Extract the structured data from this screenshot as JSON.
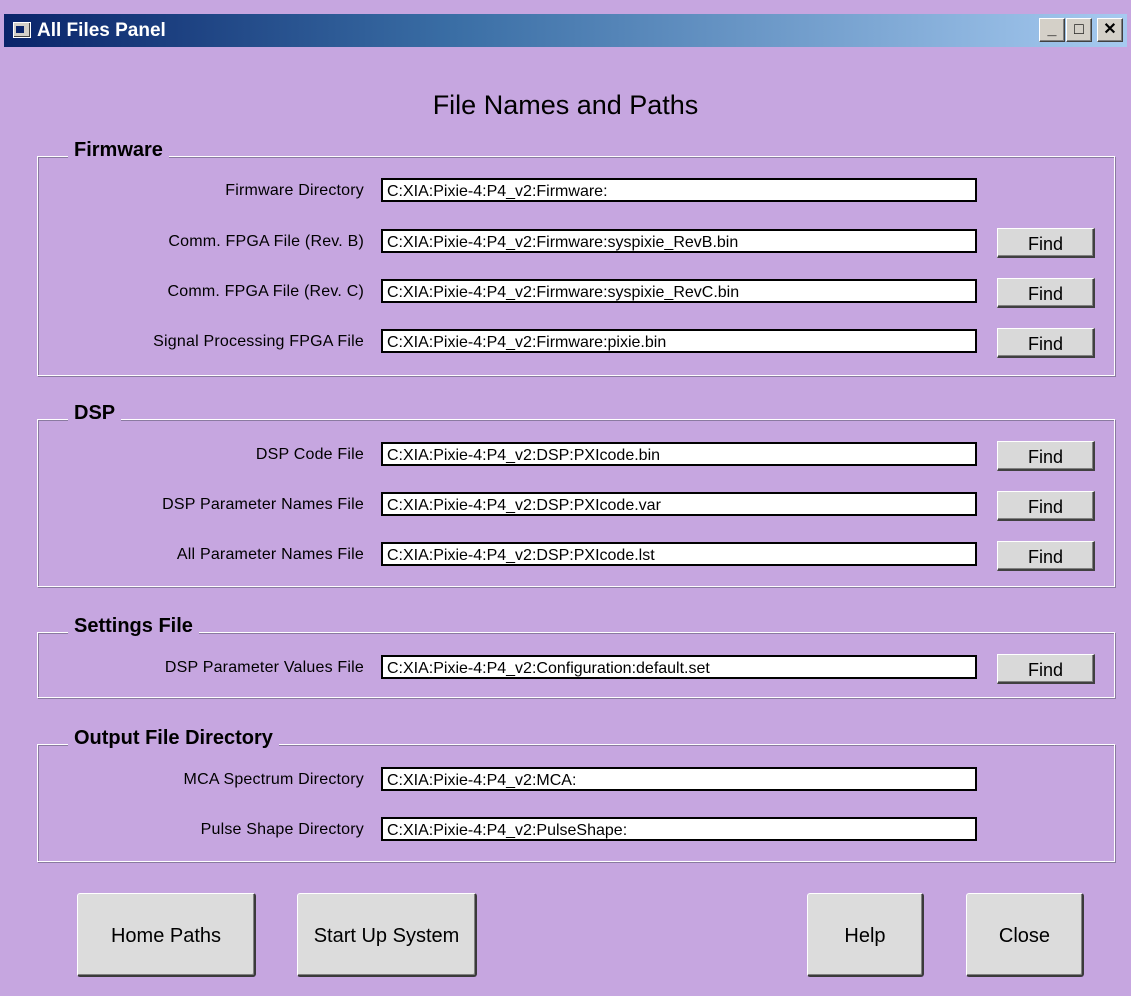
{
  "window": {
    "title": "All Files Panel",
    "minimize": "_",
    "maximize": "□",
    "close": "✕"
  },
  "panel_title": "File Names and Paths",
  "firmware": {
    "title": "Firmware",
    "rows": [
      {
        "label": "Firmware Directory",
        "value": "C:XIA:Pixie-4:P4_v2:Firmware:"
      },
      {
        "label": "Comm. FPGA File (Rev. B)",
        "value": "C:XIA:Pixie-4:P4_v2:Firmware:syspixie_RevB.bin",
        "button": "Find"
      },
      {
        "label": "Comm. FPGA File (Rev. C)",
        "value": "C:XIA:Pixie-4:P4_v2:Firmware:syspixie_RevC.bin",
        "button": "Find"
      },
      {
        "label": "Signal Processing FPGA File",
        "value": "C:XIA:Pixie-4:P4_v2:Firmware:pixie.bin",
        "button": "Find"
      }
    ]
  },
  "dsp": {
    "title": "DSP",
    "rows": [
      {
        "label": "DSP Code File",
        "value": "C:XIA:Pixie-4:P4_v2:DSP:PXIcode.bin",
        "button": "Find"
      },
      {
        "label": "DSP Parameter Names File",
        "value": "C:XIA:Pixie-4:P4_v2:DSP:PXIcode.var",
        "button": "Find"
      },
      {
        "label": "All Parameter Names File",
        "value": "C:XIA:Pixie-4:P4_v2:DSP:PXIcode.lst",
        "button": "Find"
      }
    ]
  },
  "settings": {
    "title": "Settings File",
    "rows": [
      {
        "label": "DSP Parameter Values File",
        "value": "C:XIA:Pixie-4:P4_v2:Configuration:default.set",
        "button": "Find"
      }
    ]
  },
  "output": {
    "title": "Output File Directory",
    "rows": [
      {
        "label": "MCA Spectrum Directory",
        "value": "C:XIA:Pixie-4:P4_v2:MCA:"
      },
      {
        "label": "Pulse Shape Directory",
        "value": "C:XIA:Pixie-4:P4_v2:PulseShape:"
      }
    ]
  },
  "buttons": {
    "home_paths": "Home Paths",
    "start_up": "Start Up System",
    "help": "Help",
    "close": "Close"
  }
}
